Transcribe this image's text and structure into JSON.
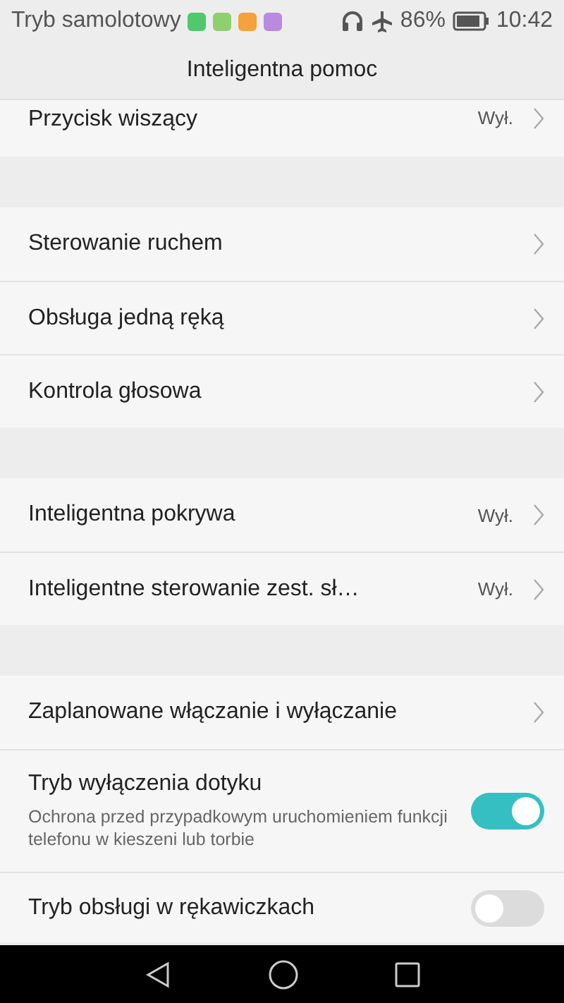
{
  "status_bar": {
    "carrier": "Tryb samolotowy",
    "battery": "86%",
    "time": "10:42"
  },
  "header": {
    "title": "Inteligentna pomoc"
  },
  "groups": [
    {
      "items": [
        {
          "kind": "link",
          "label": "Przycisk wiszący",
          "value": "Wył."
        }
      ]
    },
    {
      "items": [
        {
          "kind": "link",
          "label": "Sterowanie ruchem"
        },
        {
          "kind": "link",
          "label": "Obsługa jedną ręką"
        },
        {
          "kind": "link",
          "label": "Kontrola głosowa"
        }
      ]
    },
    {
      "items": [
        {
          "kind": "link",
          "label": "Inteligentna pokrywa",
          "value": "Wył."
        },
        {
          "kind": "link",
          "label": "Inteligentne sterowanie zest. sł…",
          "value": "Wył."
        }
      ]
    },
    {
      "items": [
        {
          "kind": "link",
          "label": "Zaplanowane włączanie i wyłączanie"
        },
        {
          "kind": "switch",
          "label": "Tryb wyłączenia dotyku",
          "description": "Ochrona przed przypadkowym uruchomieniem funkcji telefonu w kieszeni lub torbie",
          "on": true
        },
        {
          "kind": "switch",
          "label": "Tryb obsługi w rękawiczkach",
          "on": false
        }
      ]
    }
  ]
}
